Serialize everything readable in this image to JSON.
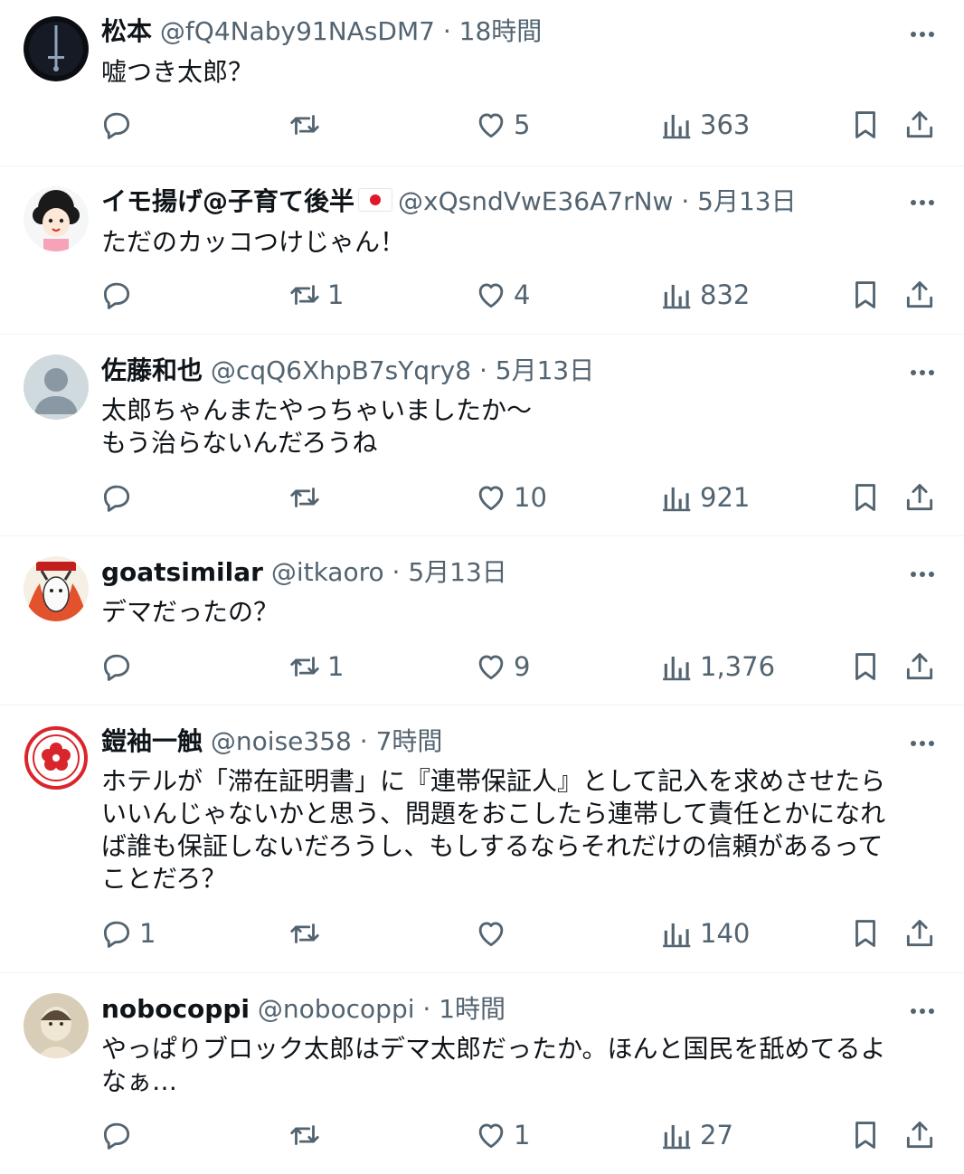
{
  "tweets": [
    {
      "name": "松本",
      "handle": "@fQ4Naby91NAsDM7",
      "sep": "·",
      "time": "18時間",
      "text": "嘘つき太郎？",
      "replies": "",
      "retweets": "",
      "likes": "5",
      "views": "363",
      "avatar": "avatar-sword-icon"
    },
    {
      "name": "イモ揚げ@子育て後半",
      "handle": "@xQsndVwE36A7rNw",
      "sep": "·",
      "time": "5月13日",
      "text": "ただのカッコつけじゃん！",
      "replies": "",
      "retweets": "1",
      "likes": "4",
      "views": "832",
      "avatar": "avatar-cartoon-woman-icon",
      "flag": "japan-flag-icon"
    },
    {
      "name": "佐藤和也",
      "handle": "@cqQ6XhpB7sYqry8",
      "sep": "·",
      "time": "5月13日",
      "text": "太郎ちゃんまたやっちゃいましたか〜\nもう治らないんだろうね",
      "replies": "",
      "retweets": "",
      "likes": "10",
      "views": "921",
      "avatar": "avatar-default-icon"
    },
    {
      "name": "goatsimilar",
      "handle": "@itkaoro",
      "sep": "·",
      "time": "5月13日",
      "text": "デマだったの？",
      "replies": "",
      "retweets": "1",
      "likes": "9",
      "views": "1,376",
      "avatar": "avatar-goat-icon"
    },
    {
      "name": "鎧袖一触",
      "handle": "@noise358",
      "sep": "·",
      "time": "7時間",
      "text": "ホテルが「滞在証明書」に『連帯保証人』として記入を求めさせたら\nいいんじゃないかと思う、問題をおこしたら連帯して責任とかになれ\nば誰も保証しないだろうし、もしするならそれだけの信頼があるって\nことだろ？",
      "replies": "1",
      "retweets": "",
      "likes": "",
      "views": "140",
      "avatar": "avatar-red-crest-icon"
    },
    {
      "name": "nobocoppi",
      "handle": "@nobocoppi",
      "sep": "·",
      "time": "1時間",
      "text": "やっぱりブロック太郎はデマ太郎だったか。ほんと国民を舐めてるよ\nなぁ…",
      "replies": "",
      "retweets": "",
      "likes": "1",
      "views": "27",
      "avatar": "avatar-photo-baby-icon"
    }
  ],
  "colors": {
    "text": "#0f1419",
    "secondary": "#536471",
    "divider": "#eff3f4"
  }
}
